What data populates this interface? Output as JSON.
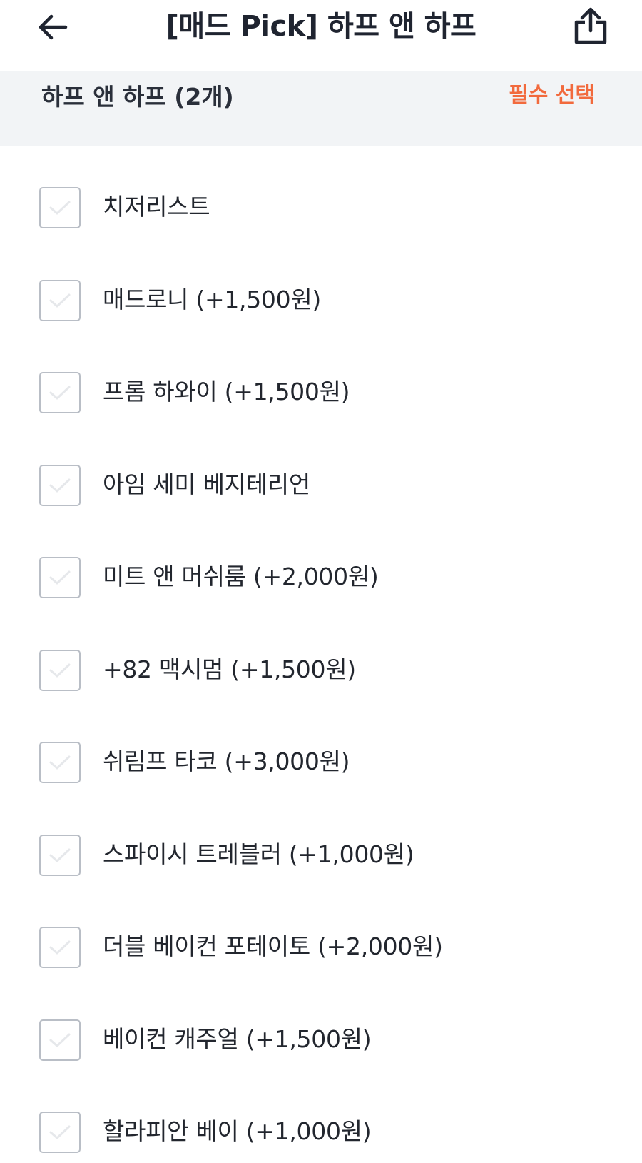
{
  "header": {
    "title": "[매드 Pick] 하프 앤 하프",
    "back_icon": "arrow-left-icon",
    "share_icon": "share-icon"
  },
  "section": {
    "title": "하프 앤 하프 (2개)",
    "required_label": "필수 선택"
  },
  "colors": {
    "accent": "#f26a3d",
    "section_bg": "#f2f4f6",
    "checkbox_border": "#b9bec6",
    "check_mark": "#e6e8eb"
  },
  "options": [
    {
      "label": "치저리스트",
      "checked": false
    },
    {
      "label": "매드로니 (+1,500원)",
      "checked": false
    },
    {
      "label": "프롬 하와이 (+1,500원)",
      "checked": false
    },
    {
      "label": "아임 세미 베지테리언",
      "checked": false
    },
    {
      "label": "미트 앤 머쉬룸 (+2,000원)",
      "checked": false
    },
    {
      "label": "+82 맥시멈 (+1,500원)",
      "checked": false
    },
    {
      "label": "쉬림프 타코 (+3,000원)",
      "checked": false
    },
    {
      "label": "스파이시 트레블러 (+1,000원)",
      "checked": false
    },
    {
      "label": "더블 베이컨 포테이토 (+2,000원)",
      "checked": false
    },
    {
      "label": "베이컨 캐주얼 (+1,500원)",
      "checked": false
    },
    {
      "label": "할라피안 베이 (+1,000원)",
      "checked": false
    }
  ]
}
